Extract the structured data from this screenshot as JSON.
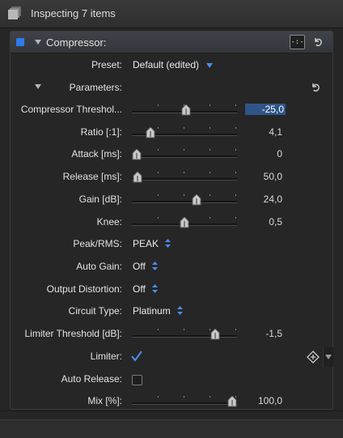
{
  "header": {
    "title": "Inspecting 7 items",
    "icon": "inspector-stack-icon"
  },
  "panel": {
    "title": "Compressor:",
    "preset_button_label": "-:-",
    "preset": {
      "label": "Preset:",
      "value": "Default (edited)"
    },
    "parameters_label": "Parameters:"
  },
  "params": {
    "threshold": {
      "label": "Compressor Threshol...",
      "value": "-25,0",
      "level": 0.52
    },
    "ratio": {
      "label": "Ratio [:1]:",
      "value": "4,1",
      "level": 0.14
    },
    "attack": {
      "label": "Attack [ms]:",
      "value": "0",
      "level": 0.0
    },
    "release": {
      "label": "Release [ms]:",
      "value": "50,0",
      "level": 0.01
    },
    "gain": {
      "label": "Gain [dB]:",
      "value": "24,0",
      "level": 0.63
    },
    "knee": {
      "label": "Knee:",
      "value": "0,5",
      "level": 0.5
    },
    "peakrms": {
      "label": "Peak/RMS:",
      "value": "PEAK"
    },
    "autogain": {
      "label": "Auto Gain:",
      "value": "Off"
    },
    "outdist": {
      "label": "Output Distortion:",
      "value": "Off"
    },
    "circuit": {
      "label": "Circuit Type:",
      "value": "Platinum"
    },
    "limthresh": {
      "label": "Limiter Threshold [dB]:",
      "value": "-1,5",
      "level": 0.82
    },
    "limiter": {
      "label": "Limiter:",
      "checked": true
    },
    "autorelease": {
      "label": "Auto Release:",
      "checked": false
    },
    "mix": {
      "label": "Mix [%]:",
      "value": "100,0",
      "level": 1.0
    }
  },
  "colors": {
    "accent": "#2e7be8",
    "selection": "#2f5588",
    "background": "#262626"
  }
}
